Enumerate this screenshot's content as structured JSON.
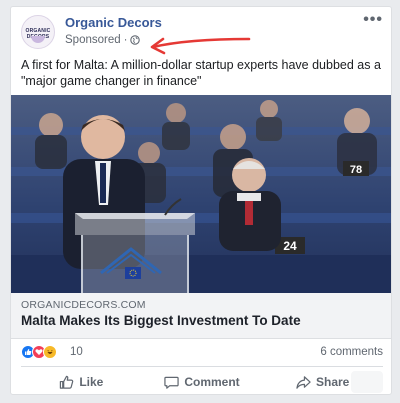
{
  "post": {
    "page_name": "Organic Decors",
    "avatar_text": "ORGANIC DECORS",
    "sponsored_label": "Sponsored",
    "dot": "·",
    "more_label": "•••",
    "text": "A first for Malta: A million-dollar startup experts have dubbed as a \"major game changer in finance\"",
    "image": {
      "placard_1": "78",
      "placard_2": "24"
    },
    "link": {
      "domain": "ORGANICDECORS.COM",
      "headline": "Malta Makes Its Biggest Investment To Date"
    },
    "reactions": {
      "icons": [
        "like-icon",
        "love-icon",
        "haha-icon"
      ],
      "count": "10",
      "comments": "6 comments"
    },
    "actions": {
      "like": "Like",
      "comment": "Comment",
      "share": "Share"
    }
  },
  "colors": {
    "page_name": "#385898",
    "annotation_arrow": "#e53935",
    "like_blue": "#1877f2",
    "love_red": "#f33e58",
    "haha_yellow": "#f7b928"
  }
}
